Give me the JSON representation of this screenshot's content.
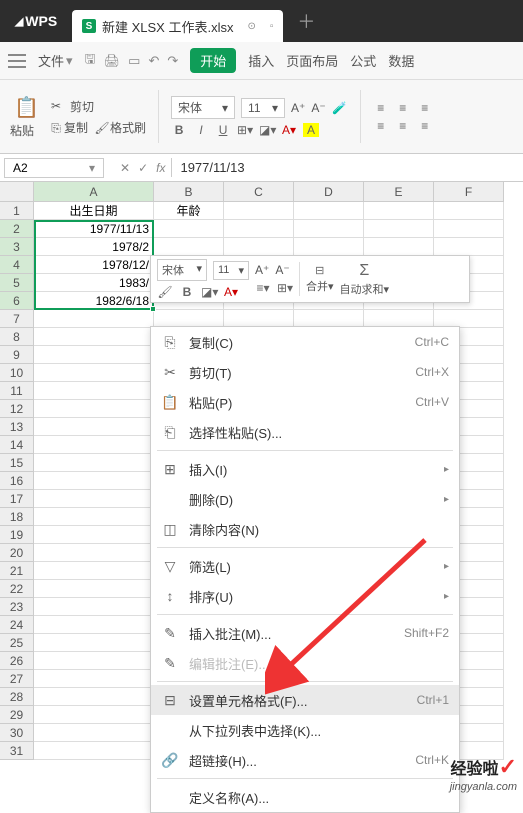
{
  "titlebar": {
    "logo": "WPS",
    "tab_active": "新建 XLSX 工作表.xlsx"
  },
  "menubar": {
    "file": "文件",
    "start": "开始",
    "insert": "插入",
    "layout": "页面布局",
    "formula": "公式",
    "data": "数据"
  },
  "toolbar": {
    "paste": "粘贴",
    "cut": "剪切",
    "copy": "复制",
    "format_painter": "格式刷",
    "font_name": "宋体",
    "font_size": "11"
  },
  "namebox": {
    "value": "A2"
  },
  "formula_bar": {
    "value": "1977/11/13"
  },
  "columns": [
    "A",
    "B",
    "C",
    "D",
    "E",
    "F"
  ],
  "headers": {
    "A1": "出生日期",
    "B1": "年龄"
  },
  "data_cells": {
    "A2": "1977/11/13",
    "A3": "1978/2",
    "A4": "1978/12/",
    "A5": "1983/",
    "A6": "1982/6/18"
  },
  "mini_toolbar": {
    "font": "宋体",
    "size": "11",
    "merge": "合并",
    "sum": "自动求和"
  },
  "context_menu": {
    "copy": {
      "label": "复制(C)",
      "shortcut": "Ctrl+C"
    },
    "cut": {
      "label": "剪切(T)",
      "shortcut": "Ctrl+X"
    },
    "paste": {
      "label": "粘贴(P)",
      "shortcut": "Ctrl+V"
    },
    "paste_sp": {
      "label": "选择性粘贴(S)..."
    },
    "insert": {
      "label": "插入(I)"
    },
    "delete": {
      "label": "删除(D)"
    },
    "clear": {
      "label": "清除内容(N)"
    },
    "filter": {
      "label": "筛选(L)"
    },
    "sort": {
      "label": "排序(U)"
    },
    "comment": {
      "label": "插入批注(M)...",
      "shortcut": "Shift+F2"
    },
    "edit_comment": {
      "label": "编辑批注(E)..."
    },
    "format": {
      "label": "设置单元格格式(F)...",
      "shortcut": "Ctrl+1"
    },
    "dropdown": {
      "label": "从下拉列表中选择(K)..."
    },
    "hyperlink": {
      "label": "超链接(H)...",
      "shortcut": "Ctrl+K"
    },
    "def_name": {
      "label": "定义名称(A)..."
    }
  },
  "watermark": {
    "main": "经验啦",
    "sub": "jingyanla.com"
  }
}
